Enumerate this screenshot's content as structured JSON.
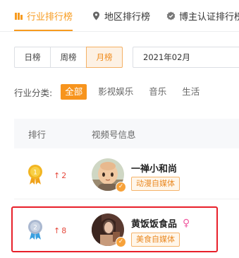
{
  "tabs": [
    {
      "label": "行业排行榜",
      "icon": "bar-chart-icon",
      "active": true
    },
    {
      "label": "地区排行榜",
      "icon": "location-pin-icon",
      "active": false
    },
    {
      "label": "博主认证排行榜",
      "icon": "verified-badge-icon",
      "active": false
    }
  ],
  "period": {
    "options": [
      "日榜",
      "周榜",
      "月榜"
    ],
    "selected": "月榜",
    "date_value": "2021年02月"
  },
  "category": {
    "label": "行业分类:",
    "options": [
      "全部",
      "影视娱乐",
      "音乐",
      "生活"
    ],
    "selected": "全部"
  },
  "table": {
    "headers": {
      "rank": "排行",
      "info": "视频号信息"
    },
    "rows": [
      {
        "rank": "1",
        "trend": "2",
        "name": "一禅小和尚",
        "tag": "动漫自媒体",
        "gender": ""
      },
      {
        "rank": "2",
        "trend": "8",
        "name": "黄饭饭食品",
        "tag": "美食自媒体",
        "gender": "♀"
      }
    ]
  },
  "colors": {
    "accent": "#f7941d",
    "highlight": "#e8202a",
    "gold": "#f2b522",
    "silver": "#aab8d0"
  }
}
